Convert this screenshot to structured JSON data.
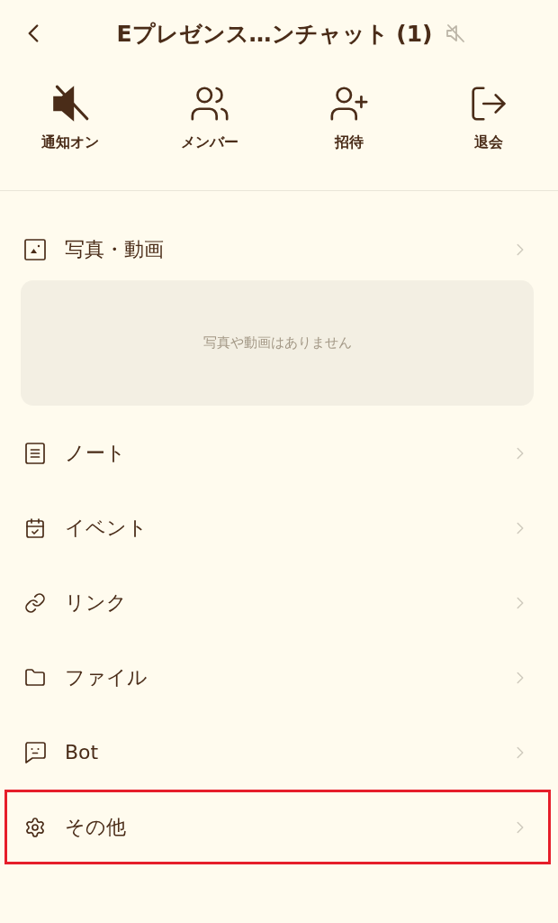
{
  "header": {
    "title": "Eプレゼンス…ンチャット (1)",
    "muted": true
  },
  "actions": [
    {
      "kind": "mute",
      "label": "通知オン"
    },
    {
      "kind": "members",
      "label": "メンバー"
    },
    {
      "kind": "invite",
      "label": "招待"
    },
    {
      "kind": "leave",
      "label": "退会"
    }
  ],
  "menu": [
    {
      "kind": "photos",
      "label": "写真・動画",
      "empty_text": "写真や動画はありません",
      "highlighted": false
    },
    {
      "kind": "note",
      "label": "ノート",
      "highlighted": false
    },
    {
      "kind": "event",
      "label": "イベント",
      "highlighted": false
    },
    {
      "kind": "link",
      "label": "リンク",
      "highlighted": false
    },
    {
      "kind": "file",
      "label": "ファイル",
      "highlighted": false
    },
    {
      "kind": "bot",
      "label": "Bot",
      "highlighted": false
    },
    {
      "kind": "other",
      "label": "その他",
      "highlighted": true
    }
  ]
}
